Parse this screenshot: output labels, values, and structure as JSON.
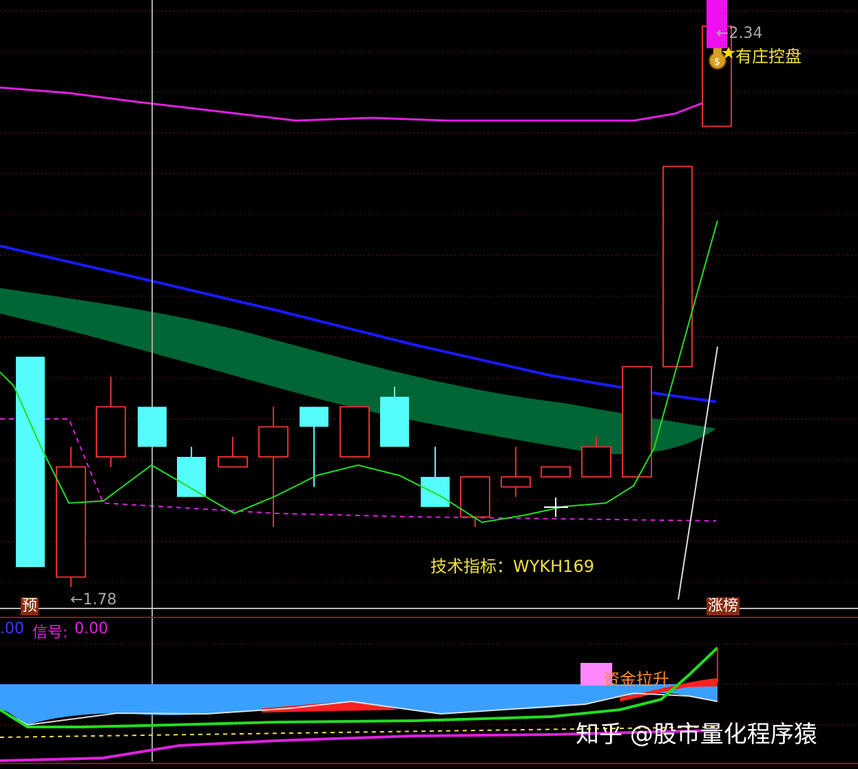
{
  "main_panel": {
    "indicator_label": "技术指标：WYKH169",
    "low_marker": "←1.78",
    "high_marker": "←2.34",
    "banker_label": "有庄控盘",
    "tag_left": "预",
    "tag_right": "涨榜"
  },
  "sub_panel": {
    "value_prefix": ".00",
    "signal_label": "信号:",
    "signal_value": "0.00",
    "fund_label": "资金拉升"
  },
  "watermark": "知乎 @股市量化程序猿",
  "colors": {
    "background": "#000000",
    "grid": "#7a1414",
    "up_candle": "#e03030",
    "down_candle": "#54fcfc",
    "ma_green": "#22dd22",
    "ma_blue": "#1a1aff",
    "ma_magenta": "#e020e0",
    "band": "#006633",
    "text_yellow": "#f0e040",
    "signal_blue": "#3aa0ff"
  },
  "chart_data": {
    "type": "candlestick",
    "title": "技术指标：WYKH169",
    "price_markers": {
      "low": 1.78,
      "high": 2.34
    },
    "candles": [
      {
        "dir": "down",
        "open": 2.01,
        "close": 1.8,
        "high": 2.01,
        "low": 1.8
      },
      {
        "dir": "up",
        "open": 1.79,
        "close": 1.9,
        "high": 1.92,
        "low": 1.78
      },
      {
        "dir": "up",
        "open": 1.91,
        "close": 1.96,
        "high": 1.99,
        "low": 1.9
      },
      {
        "dir": "down",
        "open": 1.96,
        "close": 1.92,
        "high": 1.96,
        "low": 1.92
      },
      {
        "dir": "down",
        "open": 1.91,
        "close": 1.87,
        "high": 1.92,
        "low": 1.87
      },
      {
        "dir": "up",
        "open": 1.9,
        "close": 1.91,
        "high": 1.93,
        "low": 1.9
      },
      {
        "dir": "up",
        "open": 1.91,
        "close": 1.94,
        "high": 1.96,
        "low": 1.84
      },
      {
        "dir": "down",
        "open": 1.96,
        "close": 1.94,
        "high": 1.96,
        "low": 1.88
      },
      {
        "dir": "up",
        "open": 1.91,
        "close": 1.96,
        "high": 1.96,
        "low": 1.91
      },
      {
        "dir": "down",
        "open": 1.97,
        "close": 1.92,
        "high": 1.98,
        "low": 1.92
      },
      {
        "dir": "down",
        "open": 1.89,
        "close": 1.86,
        "high": 1.92,
        "low": 1.86
      },
      {
        "dir": "up",
        "open": 1.85,
        "close": 1.89,
        "high": 1.89,
        "low": 1.84
      },
      {
        "dir": "up",
        "open": 1.88,
        "close": 1.89,
        "high": 1.92,
        "low": 1.87
      },
      {
        "dir": "up",
        "open": 1.89,
        "close": 1.9,
        "high": 1.9,
        "low": 1.89
      },
      {
        "dir": "up",
        "open": 1.89,
        "close": 1.92,
        "high": 1.93,
        "low": 1.89
      },
      {
        "dir": "up",
        "open": 1.89,
        "close": 2.0,
        "high": 2.0,
        "low": 1.89
      },
      {
        "dir": "up",
        "open": 2.0,
        "close": 2.2,
        "high": 2.2,
        "low": 2.0
      },
      {
        "dir": "up",
        "open": 2.24,
        "close": 2.34,
        "high": 2.34,
        "low": 2.24
      }
    ]
  }
}
